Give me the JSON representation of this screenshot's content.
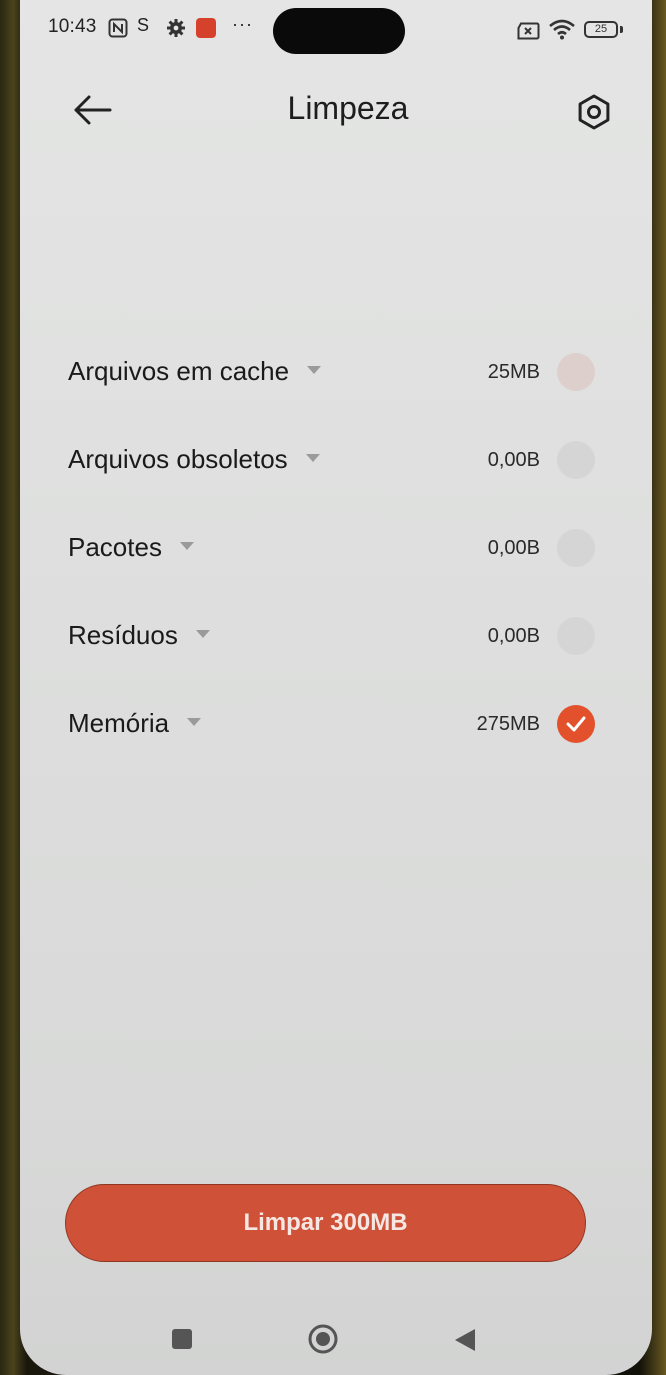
{
  "status_bar": {
    "time": "10:43",
    "battery": "25",
    "icons": [
      "nfc-icon",
      "s-icon",
      "gear-icon",
      "app-notification-icon",
      "more-dots-icon",
      "sim-icon",
      "wifi-icon",
      "battery-icon"
    ],
    "more": "···",
    "s_glyph": "S"
  },
  "header": {
    "title": "Limpeza",
    "back_icon": "arrow-left-icon",
    "settings_icon": "settings-hexagon-icon"
  },
  "items": [
    {
      "label": "Arquivos em cache",
      "size": "25MB",
      "state": "pending"
    },
    {
      "label": "Arquivos obsoletos",
      "size": "0,00B",
      "state": "unchecked"
    },
    {
      "label": "Pacotes",
      "size": "0,00B",
      "state": "unchecked"
    },
    {
      "label": "Resíduos",
      "size": "0,00B",
      "state": "unchecked"
    },
    {
      "label": "Memória",
      "size": "275MB",
      "state": "checked"
    }
  ],
  "action": {
    "label": "Limpar 300MB"
  },
  "colors": {
    "accent": "#e3502c",
    "button": "#cf5138",
    "background": "#dedfde"
  },
  "navbar": {
    "icons": [
      "square-recents-icon",
      "circle-home-icon",
      "triangle-back-icon"
    ]
  }
}
